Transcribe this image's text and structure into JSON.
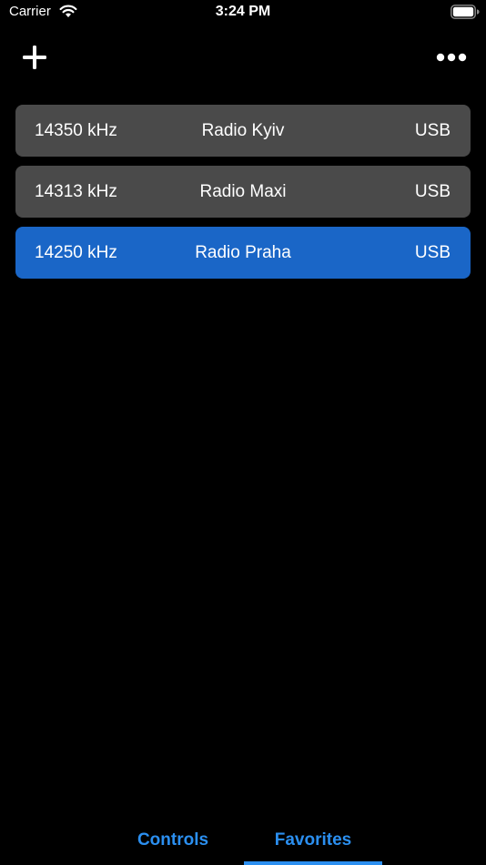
{
  "status_bar": {
    "carrier": "Carrier",
    "time": "3:24 PM",
    "icons": [
      "wifi-icon",
      "battery-icon"
    ]
  },
  "toolbar": {
    "add_icon": "plus-icon",
    "more_icon": "ellipsis-icon"
  },
  "favorites": [
    {
      "frequency": "14350 kHz",
      "name": "Radio Kyiv",
      "mode": "USB",
      "selected": false
    },
    {
      "frequency": "14313 kHz",
      "name": "Radio Maxi",
      "mode": "USB",
      "selected": false
    },
    {
      "frequency": "14250 kHz",
      "name": "Radio Praha",
      "mode": "USB",
      "selected": true
    }
  ],
  "tabs": [
    {
      "label": "Controls",
      "active": false
    },
    {
      "label": "Favorites",
      "active": true
    }
  ],
  "colors": {
    "background": "#000000",
    "row_background": "#4a4a4a",
    "row_selected": "#1a66c7",
    "accent": "#2b8ff0",
    "text": "#ffffff"
  }
}
